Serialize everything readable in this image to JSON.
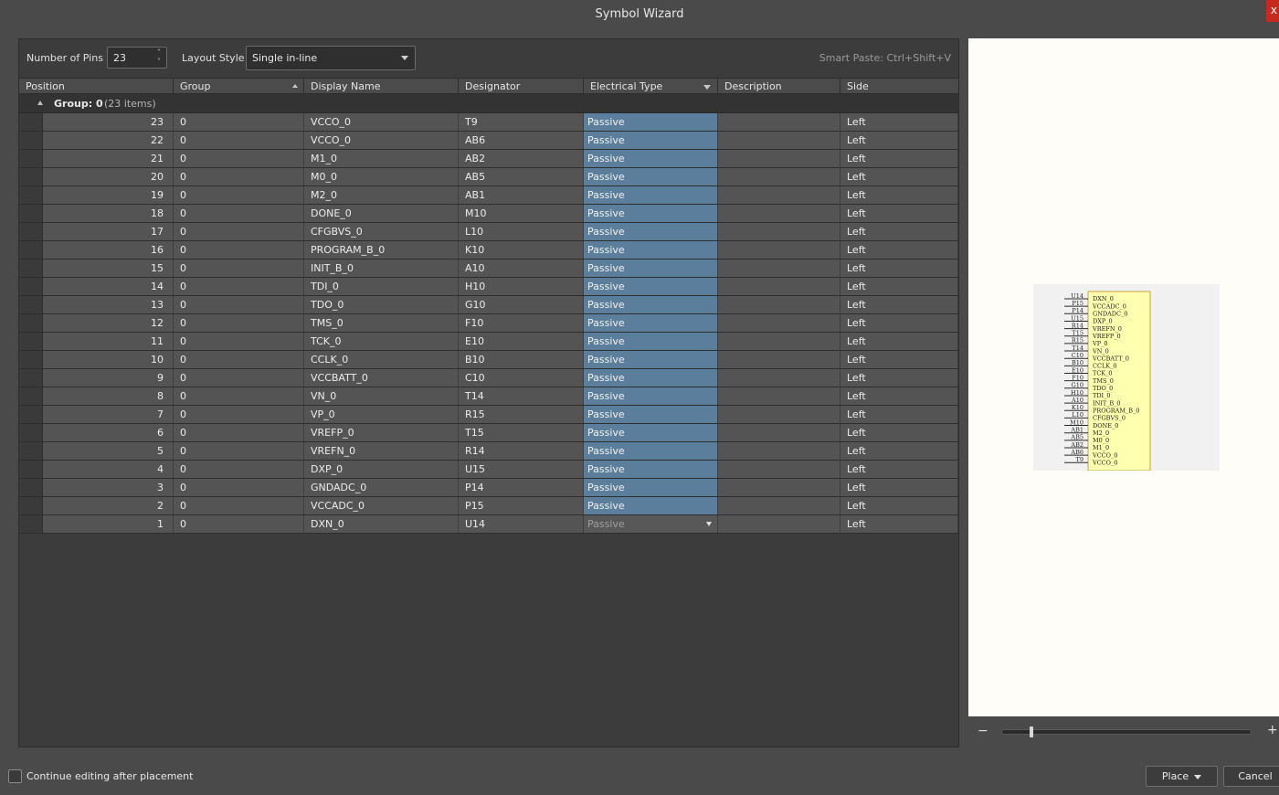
{
  "window": {
    "title": "Symbol Wizard",
    "close_label": "x"
  },
  "toolbar": {
    "pins_label": "Number of Pins",
    "pins_value": "23",
    "layout_label": "Layout Style",
    "layout_value": "Single in-line",
    "smart_paste": "Smart Paste: Ctrl+Shift+V"
  },
  "columns": [
    "Position",
    "Group",
    "Display Name",
    "Designator",
    "Electrical Type",
    "Description",
    "Side"
  ],
  "group": {
    "label": "Group: 0",
    "count": "(23 items)"
  },
  "rows": [
    {
      "pos": "23",
      "group": "0",
      "name": "VCCO_0",
      "des": "T9",
      "etype": "Passive",
      "desc": "",
      "side": "Left"
    },
    {
      "pos": "22",
      "group": "0",
      "name": "VCCO_0",
      "des": "AB6",
      "etype": "Passive",
      "desc": "",
      "side": "Left"
    },
    {
      "pos": "21",
      "group": "0",
      "name": "M1_0",
      "des": "AB2",
      "etype": "Passive",
      "desc": "",
      "side": "Left"
    },
    {
      "pos": "20",
      "group": "0",
      "name": "M0_0",
      "des": "AB5",
      "etype": "Passive",
      "desc": "",
      "side": "Left"
    },
    {
      "pos": "19",
      "group": "0",
      "name": "M2_0",
      "des": "AB1",
      "etype": "Passive",
      "desc": "",
      "side": "Left"
    },
    {
      "pos": "18",
      "group": "0",
      "name": "DONE_0",
      "des": "M10",
      "etype": "Passive",
      "desc": "",
      "side": "Left"
    },
    {
      "pos": "17",
      "group": "0",
      "name": "CFGBVS_0",
      "des": "L10",
      "etype": "Passive",
      "desc": "",
      "side": "Left"
    },
    {
      "pos": "16",
      "group": "0",
      "name": "PROGRAM_B_0",
      "des": "K10",
      "etype": "Passive",
      "desc": "",
      "side": "Left"
    },
    {
      "pos": "15",
      "group": "0",
      "name": "INIT_B_0",
      "des": "A10",
      "etype": "Passive",
      "desc": "",
      "side": "Left"
    },
    {
      "pos": "14",
      "group": "0",
      "name": "TDI_0",
      "des": "H10",
      "etype": "Passive",
      "desc": "",
      "side": "Left"
    },
    {
      "pos": "13",
      "group": "0",
      "name": "TDO_0",
      "des": "G10",
      "etype": "Passive",
      "desc": "",
      "side": "Left"
    },
    {
      "pos": "12",
      "group": "0",
      "name": "TMS_0",
      "des": "F10",
      "etype": "Passive",
      "desc": "",
      "side": "Left"
    },
    {
      "pos": "11",
      "group": "0",
      "name": "TCK_0",
      "des": "E10",
      "etype": "Passive",
      "desc": "",
      "side": "Left"
    },
    {
      "pos": "10",
      "group": "0",
      "name": "CCLK_0",
      "des": "B10",
      "etype": "Passive",
      "desc": "",
      "side": "Left"
    },
    {
      "pos": "9",
      "group": "0",
      "name": "VCCBATT_0",
      "des": "C10",
      "etype": "Passive",
      "desc": "",
      "side": "Left"
    },
    {
      "pos": "8",
      "group": "0",
      "name": "VN_0",
      "des": "T14",
      "etype": "Passive",
      "desc": "",
      "side": "Left"
    },
    {
      "pos": "7",
      "group": "0",
      "name": "VP_0",
      "des": "R15",
      "etype": "Passive",
      "desc": "",
      "side": "Left"
    },
    {
      "pos": "6",
      "group": "0",
      "name": "VREFP_0",
      "des": "T15",
      "etype": "Passive",
      "desc": "",
      "side": "Left"
    },
    {
      "pos": "5",
      "group": "0",
      "name": "VREFN_0",
      "des": "R14",
      "etype": "Passive",
      "desc": "",
      "side": "Left"
    },
    {
      "pos": "4",
      "group": "0",
      "name": "DXP_0",
      "des": "U15",
      "etype": "Passive",
      "desc": "",
      "side": "Left"
    },
    {
      "pos": "3",
      "group": "0",
      "name": "GNDADC_0",
      "des": "P14",
      "etype": "Passive",
      "desc": "",
      "side": "Left"
    },
    {
      "pos": "2",
      "group": "0",
      "name": "VCCADC_0",
      "des": "P15",
      "etype": "Passive",
      "desc": "",
      "side": "Left"
    },
    {
      "pos": "1",
      "group": "0",
      "name": "DXN_0",
      "des": "U14",
      "etype": "Passive",
      "desc": "",
      "side": "Left",
      "editing": true
    }
  ],
  "preview": {
    "symbol_pins": [
      {
        "des": "U14",
        "name": "DXN_0"
      },
      {
        "des": "P15",
        "name": "VCCADC_0"
      },
      {
        "des": "P14",
        "name": "GNDADC_0"
      },
      {
        "des": "U15",
        "name": "DXP_0"
      },
      {
        "des": "R14",
        "name": "VREFN_0"
      },
      {
        "des": "T15",
        "name": "VREFP_0"
      },
      {
        "des": "R15",
        "name": "VP_0"
      },
      {
        "des": "T14",
        "name": "VN_0"
      },
      {
        "des": "C10",
        "name": "VCCBATT_0"
      },
      {
        "des": "B10",
        "name": "CCLK_0"
      },
      {
        "des": "E10",
        "name": "TCK_0"
      },
      {
        "des": "F10",
        "name": "TMS_0"
      },
      {
        "des": "G10",
        "name": "TDO_0"
      },
      {
        "des": "H10",
        "name": "TDI_0"
      },
      {
        "des": "A10",
        "name": "INIT_B_0"
      },
      {
        "des": "K10",
        "name": "PROGRAM_B_0"
      },
      {
        "des": "L10",
        "name": "CFGBVS_0"
      },
      {
        "des": "M10",
        "name": "DONE_0"
      },
      {
        "des": "AB1",
        "name": "M2_0"
      },
      {
        "des": "AB5",
        "name": "M0_0"
      },
      {
        "des": "AB2",
        "name": "M1_0"
      },
      {
        "des": "AB6",
        "name": "VCCO_0"
      },
      {
        "des": "T9",
        "name": "VCCO_0"
      }
    ],
    "zoom_minus": "−",
    "zoom_plus": "+",
    "zoom_level": 0.12
  },
  "footer": {
    "continue_label": "Continue editing after placement",
    "continue_checked": false,
    "place_label": "Place",
    "cancel_label": "Cancel"
  },
  "colors": {
    "selection": "#5a7e9c",
    "symbol_body": "#ffffb0",
    "preview_bg": "#fffdf7"
  }
}
